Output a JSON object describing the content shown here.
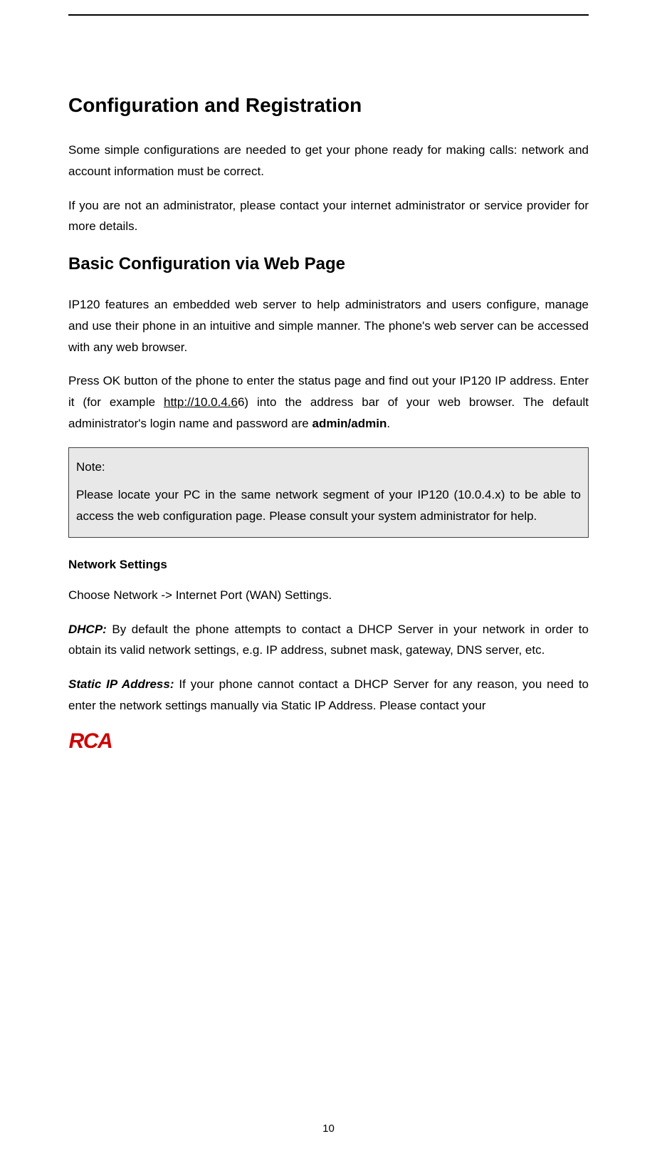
{
  "heading1": "Configuration and Registration",
  "para1": "Some simple configurations are needed to get your phone ready for making calls: network and account information must be correct.",
  "para2": "If you are not an administrator, please contact your internet administrator or service provider for more details.",
  "heading2": "Basic Configuration via Web Page",
  "para3": "IP120 features an embedded web server to help administrators and users configure, manage and use their phone in an intuitive and simple manner. The phone's web server can be accessed with any web browser.",
  "para4_pre": "Press OK button of the phone to enter the status page and find out your IP120 IP address. Enter it (for example ",
  "para4_link": "http://10.0.4.6",
  "para4_mid": "6) into the address bar of your web browser. The default administrator's login name and password are ",
  "para4_bold": "admin/admin",
  "para4_end": ".",
  "note_label": "Note:",
  "note_body": "Please locate your PC in the same network segment of your IP120 (10.0.4.x) to be able to access the web configuration page. Please consult your system administrator for help.",
  "heading3": "Network Settings",
  "para5": "Choose Network -> Internet Port (WAN) Settings.",
  "para6_label": "DHCP:",
  "para6_body": " By default the phone attempts to contact a DHCP Server in your network in order to obtain its valid network settings, e.g. IP address, subnet mask, gateway, DNS server, etc.",
  "para7_label": "Static IP Address:",
  "para7_body": " If your phone cannot contact a DHCP Server for any reason, you need to enter the network settings manually via Static IP Address. Please contact your",
  "logo_text": "RCA",
  "page_number": "10"
}
